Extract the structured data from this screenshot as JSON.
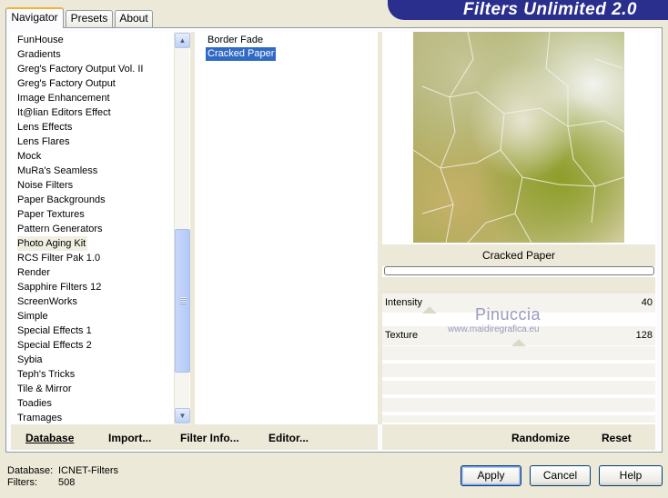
{
  "app": {
    "title": "Filters Unlimited 2.0"
  },
  "tabs": [
    {
      "label": "Navigator"
    },
    {
      "label": "Presets"
    },
    {
      "label": "About"
    }
  ],
  "categories": [
    "FunHouse",
    "Gradients",
    "Greg's Factory Output Vol. II",
    "Greg's Factory Output",
    "Image Enhancement",
    "It@lian Editors Effect",
    "Lens Effects",
    "Lens Flares",
    "Mock",
    "MuRa's Seamless",
    "Noise Filters",
    "Paper Backgrounds",
    "Paper Textures",
    "Pattern Generators",
    "Photo Aging Kit",
    "RCS Filter Pak 1.0",
    "Render",
    "Sapphire Filters 12",
    "ScreenWorks",
    "Simple",
    "Special Effects 1",
    "Special Effects 2",
    "Sybia",
    "Teph's Tricks",
    "Tile & Mirror",
    "Toadies",
    "Tramages"
  ],
  "highlighted_category": "Photo Aging Kit",
  "filters": [
    "Border Fade",
    "Cracked Paper"
  ],
  "selected_filter": "Cracked Paper",
  "left_actions": {
    "database": "Database",
    "import": "Import...",
    "filter_info": "Filter Info...",
    "editor": "Editor..."
  },
  "right_actions": {
    "randomize": "Randomize",
    "reset": "Reset"
  },
  "preview": {
    "filter_name": "Cracked Paper"
  },
  "params": [
    {
      "label": "Intensity",
      "value": "40"
    },
    {
      "label": "Texture",
      "value": "128"
    }
  ],
  "watermark": {
    "name": "Pinuccia",
    "url": "www.maidiregrafica.eu"
  },
  "status": {
    "database_label": "Database:",
    "database_value": "ICNET-Filters",
    "filters_label": "Filters:",
    "filters_value": "508"
  },
  "buttons": {
    "apply": "Apply",
    "cancel": "Cancel",
    "help": "Help"
  },
  "colors": {
    "banner": "#2a2f8e",
    "selection": "#316ac5",
    "window_bg": "#ece9d8"
  }
}
